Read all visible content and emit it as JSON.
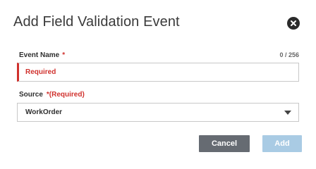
{
  "dialog": {
    "title": "Add Field Validation Event",
    "close_icon": "close-circle-icon"
  },
  "event_name": {
    "label": "Event Name",
    "required_mark": "*",
    "counter": "0 / 256",
    "value": "",
    "error_text": "Required",
    "error_color": "#d0312d"
  },
  "source": {
    "label": "Source",
    "required_mark": "*(Required)",
    "selected": "WorkOrder",
    "caret_icon": "caret-down-icon"
  },
  "actions": {
    "cancel_label": "Cancel",
    "add_label": "Add",
    "cancel_color": "#666b72",
    "add_color": "#a9cbe4",
    "add_enabled": false
  }
}
